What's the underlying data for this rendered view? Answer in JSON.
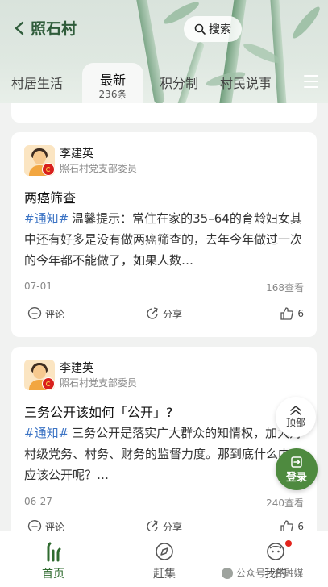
{
  "header": {
    "village_name": "照石村",
    "search_label": "搜索"
  },
  "tabs": [
    {
      "label": "村居生活"
    },
    {
      "label": "最新",
      "count": "236条",
      "active": true
    },
    {
      "label": "积分制"
    },
    {
      "label": "村民说事"
    }
  ],
  "posts": [
    {
      "author": "李建英",
      "role": "照石村党支部委员",
      "title": "两癌筛查",
      "tag": "#通知#",
      "body": "温馨提示：常住在家的35–64的育龄妇女其中还有好多是没有做两癌筛查的，去年今年做过一次的今年都不能做了，如果人数…",
      "date": "07-01",
      "views": "168查看",
      "comment_label": "评论",
      "share_label": "分享",
      "likes": "6"
    },
    {
      "author": "李建英",
      "role": "照石村党支部委员",
      "title": "三务公开该如何「公开」?",
      "tag": "#通知#",
      "body": "三务公开是落实广大群众的知情权，加大对村级党务、村务、财务的监督力度。那到底什么内容应该公开呢？…",
      "date": "06-27",
      "views": "240查看",
      "comment_label": "评论",
      "share_label": "分享",
      "likes": "6"
    }
  ],
  "float_buttons": {
    "top_label": "顶部",
    "login_label": "登录"
  },
  "bottom_nav": [
    {
      "label": "首页",
      "active": true
    },
    {
      "label": "赶集"
    },
    {
      "label": "我的"
    }
  ],
  "watermark": "公众号 · 井融媒",
  "colors": {
    "accent_green": "#2f6b2f",
    "login_green": "#4e8a3f",
    "tag_blue": "#3b73c4",
    "badge_red": "#e3241c"
  }
}
